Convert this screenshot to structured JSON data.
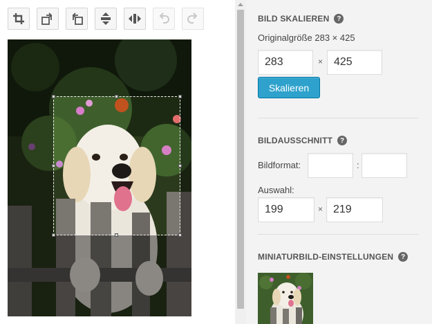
{
  "toolbar": {
    "buttons": [
      {
        "icon": "crop-icon",
        "enabled": true
      },
      {
        "icon": "rotate-left-icon",
        "enabled": true
      },
      {
        "icon": "rotate-right-icon",
        "enabled": true
      },
      {
        "icon": "flip-vertical-icon",
        "enabled": true
      },
      {
        "icon": "flip-horizontal-icon",
        "enabled": true
      },
      {
        "icon": "undo-icon",
        "enabled": false
      },
      {
        "icon": "redo-icon",
        "enabled": false
      }
    ]
  },
  "scale": {
    "title": "BILD SKALIEREN",
    "help": "?",
    "original_size": "Originalgröße 283 × 425",
    "width": "283",
    "times": "×",
    "height": "425",
    "button": "Skalieren"
  },
  "crop": {
    "title": "BILDAUSSCHNITT",
    "help": "?",
    "aspect_label": "Bildformat:",
    "aspect_width": "",
    "colon": ":",
    "aspect_height": "",
    "selection_label": "Auswahl:",
    "sel_width": "199",
    "times": "×",
    "sel_height": "219"
  },
  "thumbnail": {
    "title": "MINIATURBILD-EINSTELLUNGEN",
    "help": "?"
  },
  "colors": {
    "accent": "#2ea2cc",
    "accent_border": "#0074a2",
    "panel_bg": "#f3f3f3"
  }
}
